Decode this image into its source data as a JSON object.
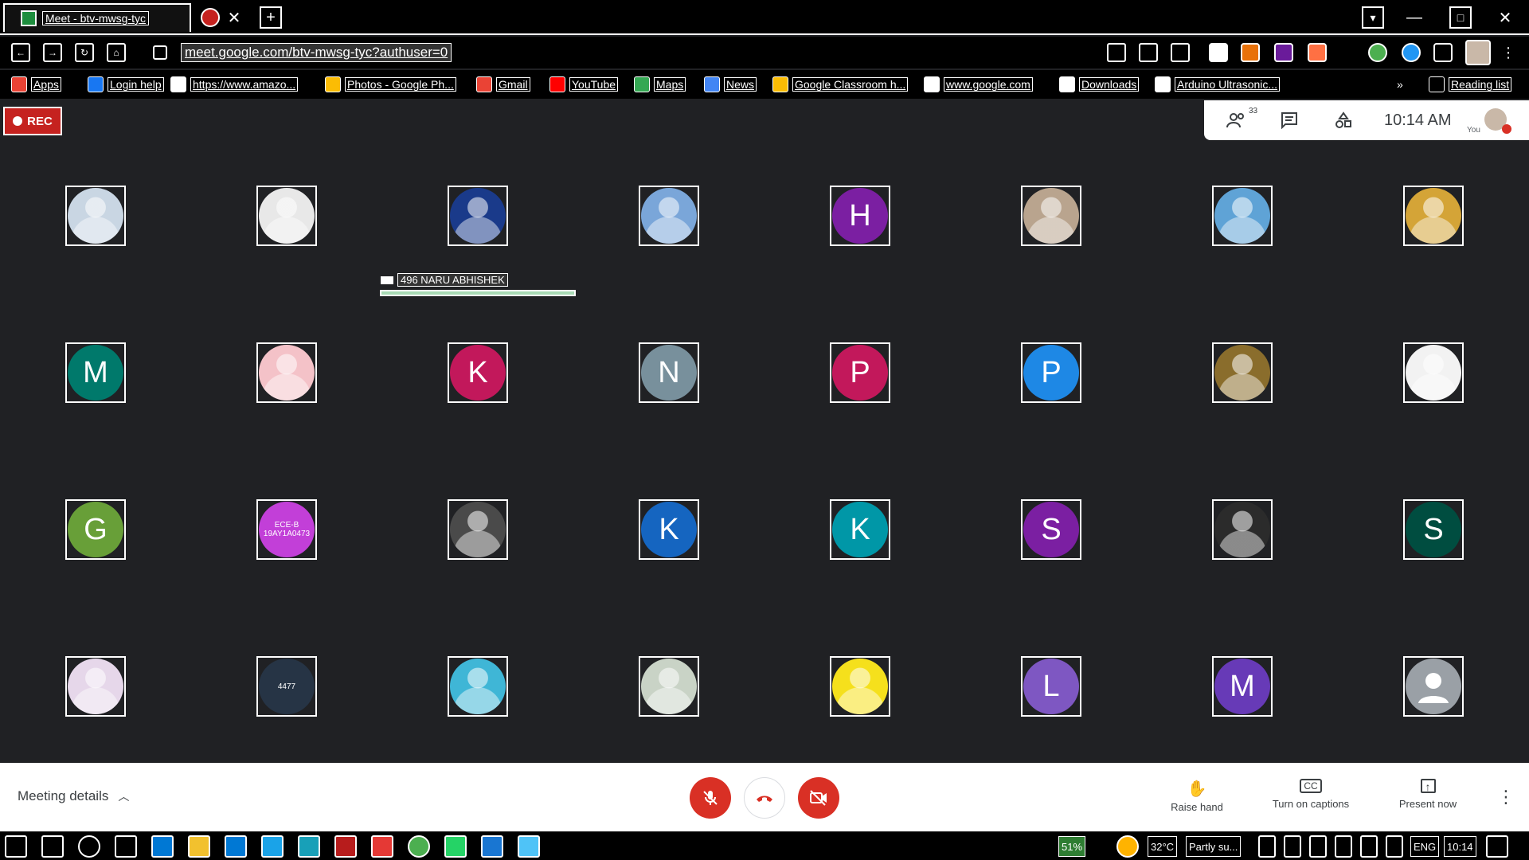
{
  "browser": {
    "tab_title": "Meet - btv-mwsg-tyc",
    "url": "meet.google.com/btv-mwsg-tyc?authuser=0"
  },
  "bookmarks": [
    {
      "label": "Apps",
      "icon": "apps-grid-icon",
      "color": "#ea4335"
    },
    {
      "label": "Login help",
      "icon": "facebook-icon",
      "color": "#1877f2"
    },
    {
      "label": "https://www.amazo...",
      "icon": "amazon-icon",
      "color": "#ffffff"
    },
    {
      "label": "Photos - Google Ph...",
      "icon": "google-photos-icon",
      "color": "#fbbc04"
    },
    {
      "label": "Gmail",
      "icon": "gmail-icon",
      "color": "#ea4335"
    },
    {
      "label": "YouTube",
      "icon": "youtube-icon",
      "color": "#ff0000"
    },
    {
      "label": "Maps",
      "icon": "maps-icon",
      "color": "#34a853"
    },
    {
      "label": "News",
      "icon": "news-icon",
      "color": "#4285f4"
    },
    {
      "label": "Google Classroom h...",
      "icon": "classroom-icon",
      "color": "#fbbc04"
    },
    {
      "label": "www.google.com",
      "icon": "google-icon",
      "color": "#ffffff"
    },
    {
      "label": "Downloads",
      "icon": "folder-icon",
      "color": "#ffffff"
    },
    {
      "label": "Arduino Ultrasonic...",
      "icon": "page-icon",
      "color": "#ffffff"
    }
  ],
  "reading_list": "Reading list",
  "meet": {
    "rec_label": "REC",
    "participants_count": "33",
    "time": "10:14 AM",
    "you_label": "You",
    "speaking_name": "496 NARU ABHISHEK",
    "meeting_details": "Meeting details",
    "raise_hand": "Raise hand",
    "captions": "Turn on captions",
    "present": "Present now"
  },
  "participants": [
    {
      "initial": "",
      "color": "#c9d6e3",
      "kind": "photo"
    },
    {
      "initial": "",
      "color": "#e8e8e8",
      "kind": "photo"
    },
    {
      "initial": "",
      "color": "#1a3a8a",
      "kind": "photo"
    },
    {
      "initial": "",
      "color": "#7aa6d9",
      "kind": "photo"
    },
    {
      "initial": "H",
      "color": "#7b1fa2",
      "kind": "letter"
    },
    {
      "initial": "",
      "color": "#b9a48e",
      "kind": "photo"
    },
    {
      "initial": "",
      "color": "#5fa3d6",
      "kind": "photo"
    },
    {
      "initial": "",
      "color": "#d4a437",
      "kind": "photo"
    },
    {
      "initial": "M",
      "color": "#00796b",
      "kind": "letter"
    },
    {
      "initial": "",
      "color": "#f4c2c8",
      "kind": "photo"
    },
    {
      "initial": "K",
      "color": "#c2185b",
      "kind": "letter"
    },
    {
      "initial": "N",
      "color": "#78909c",
      "kind": "letter"
    },
    {
      "initial": "P",
      "color": "#c2185b",
      "kind": "letter"
    },
    {
      "initial": "P",
      "color": "#1e88e5",
      "kind": "letter"
    },
    {
      "initial": "",
      "color": "#8a6d2c",
      "kind": "photo"
    },
    {
      "initial": "",
      "color": "#f2f2f2",
      "kind": "photo"
    },
    {
      "initial": "G",
      "color": "#689f38",
      "kind": "letter"
    },
    {
      "initial": "ECE-B 19AY1A0473",
      "color": "#c23fd8",
      "kind": "text"
    },
    {
      "initial": "",
      "color": "#4a4a4a",
      "kind": "photo"
    },
    {
      "initial": "K",
      "color": "#1565c0",
      "kind": "letter"
    },
    {
      "initial": "K",
      "color": "#0097a7",
      "kind": "letter"
    },
    {
      "initial": "S",
      "color": "#7b1fa2",
      "kind": "letter"
    },
    {
      "initial": "",
      "color": "#2b2b2b",
      "kind": "photo"
    },
    {
      "initial": "S",
      "color": "#004d40",
      "kind": "letter"
    },
    {
      "initial": "",
      "color": "#e6d7ea",
      "kind": "photo"
    },
    {
      "initial": "4477",
      "color": "#263445",
      "kind": "text"
    },
    {
      "initial": "",
      "color": "#3fb6d6",
      "kind": "photo"
    },
    {
      "initial": "",
      "color": "#c9d3c6",
      "kind": "photo"
    },
    {
      "initial": "",
      "color": "#f5e01c",
      "kind": "photo"
    },
    {
      "initial": "L",
      "color": "#7e57c2",
      "kind": "letter"
    },
    {
      "initial": "M",
      "color": "#673ab7",
      "kind": "letter"
    },
    {
      "initial": "",
      "color": "#9aa0a6",
      "kind": "default"
    }
  ],
  "taskbar": {
    "battery": "51%",
    "temp": "32°C",
    "weather": "Partly su...",
    "lang": "ENG",
    "clock": "10:14"
  }
}
